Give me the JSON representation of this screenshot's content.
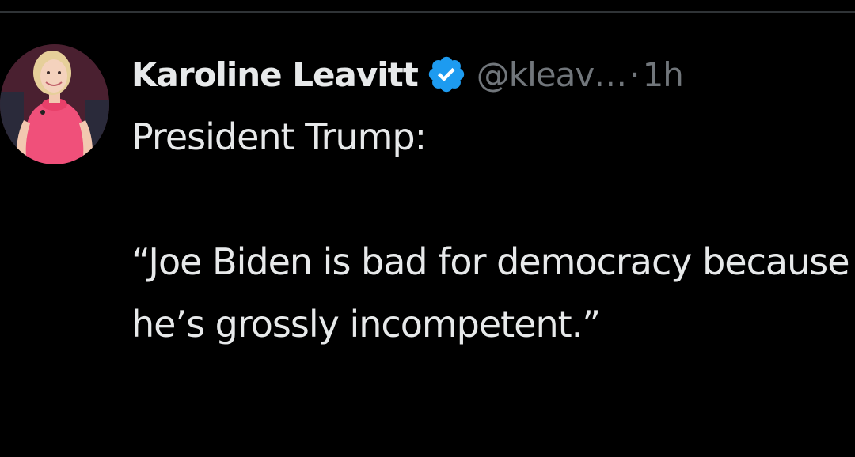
{
  "tweet": {
    "author": {
      "display_name": "Karoline Leavitt",
      "handle": "@kleav…",
      "verified_icon": "verified-badge-icon",
      "avatar": "profile-photo"
    },
    "separator": "·",
    "timestamp": "1h",
    "text": "President Trump:\n\n“Joe Biden is bad for democracy because he’s grossly incompetent.”"
  },
  "colors": {
    "background": "#000000",
    "primary_text": "#e7e9ea",
    "secondary_text": "#71767b",
    "verified_blue": "#1d9bf0",
    "divider": "#2f3336"
  }
}
